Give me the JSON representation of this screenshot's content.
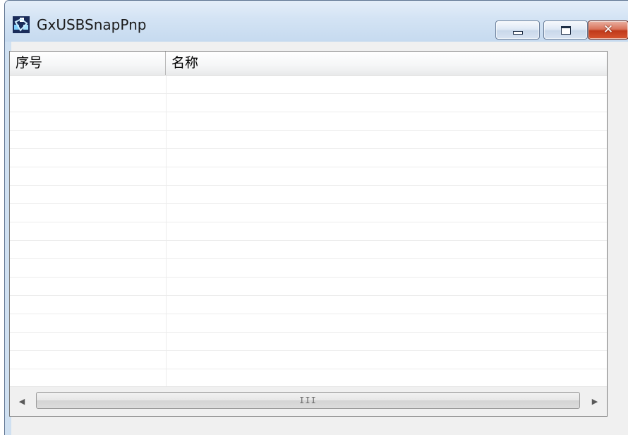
{
  "window": {
    "title": "GxUSBSnapPnp",
    "icon": "gx-app-icon",
    "buttons": {
      "minimize": "minimize",
      "maximize": "maximize",
      "close": "close"
    }
  },
  "list": {
    "columns": [
      {
        "label": "序号"
      },
      {
        "label": "名称"
      }
    ],
    "rows": []
  },
  "scrollbar": {
    "grip": "III",
    "left_arrow": "◀",
    "right_arrow": "▶"
  },
  "colors": {
    "titlebar": "#d3e3f4",
    "close_button": "#c0391a",
    "client_bg": "#f0f0f0"
  }
}
